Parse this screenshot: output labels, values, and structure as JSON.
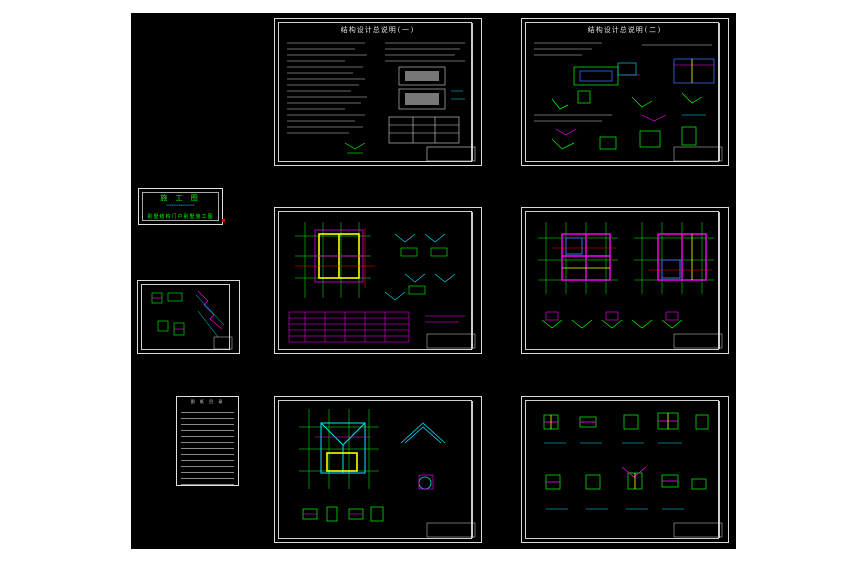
{
  "viewport": {
    "background": "#000000"
  },
  "cover": {
    "title": "施 工 图",
    "subtitle": "xxxxxxxxxxxxxxxx",
    "project": "别墅结构门户别墅施工图"
  },
  "index_sheet": {
    "title": "图 纸 目 录",
    "rows": [
      "",
      "",
      "",
      "",
      "",
      "",
      "",
      "",
      "",
      "",
      "",
      "",
      ""
    ]
  },
  "sheets": [
    {
      "id": "structure-notes-1",
      "title": "结构设计总说明(一)"
    },
    {
      "id": "structure-notes-2",
      "title": "结构设计总说明(二)"
    },
    {
      "id": "foundation-plan",
      "title": ""
    },
    {
      "id": "floor-plans",
      "title": ""
    },
    {
      "id": "roof-plan",
      "title": ""
    },
    {
      "id": "details",
      "title": ""
    },
    {
      "id": "stair-details",
      "title": ""
    }
  ],
  "colors": {
    "line_white": "#d9d9d9",
    "green": "#00ff00",
    "cyan": "#00e5ff",
    "magenta": "#ff00ff",
    "yellow": "#ffff00",
    "red": "#ff0000",
    "blue": "#3a6bff"
  }
}
